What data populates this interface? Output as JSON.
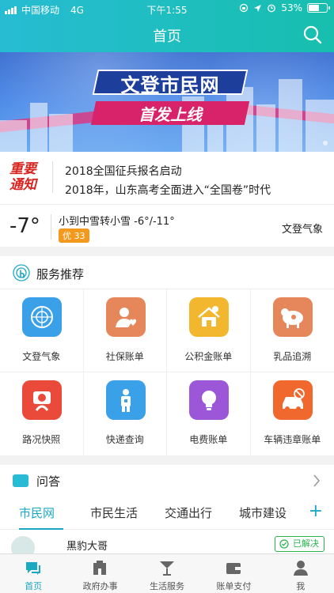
{
  "status_bar": {
    "carrier": "中国移动",
    "network": "4G",
    "time": "下午1:55",
    "battery_pct": "53%",
    "battery_level": 0.53
  },
  "nav": {
    "title": "首页",
    "search_icon": "search-icon"
  },
  "banner": {
    "title": "文登市民网",
    "subtitle": "首发上线"
  },
  "notice": {
    "logo_line1": "重要",
    "logo_line2": "通知",
    "items": [
      "2018全国征兵报名启动",
      "2018年，山东高考全面进入“全国卷”时代"
    ]
  },
  "weather": {
    "temp": "-7°",
    "condition": "小到中雪转小雪 -6°/-11°",
    "aqi": "优 33",
    "source": "文登气象"
  },
  "services": {
    "title": "服务推荐",
    "items": [
      {
        "label": "文登气象",
        "icon": "globe-icon",
        "color": "#3aa0e8"
      },
      {
        "label": "社保账单",
        "icon": "person-heart-icon",
        "color": "#e5875a"
      },
      {
        "label": "公积金账单",
        "icon": "house-coin-icon",
        "color": "#f3b72f"
      },
      {
        "label": "乳品追溯",
        "icon": "cow-icon",
        "color": "#e5875a"
      },
      {
        "label": "路况快照",
        "icon": "camera-road-icon",
        "color": "#ea4a3a"
      },
      {
        "label": "快递查询",
        "icon": "courier-icon",
        "color": "#3aa0e8"
      },
      {
        "label": "电费账单",
        "icon": "bulb-icon",
        "color": "#9c57d8"
      },
      {
        "label": "车辆违章账单",
        "icon": "car-ban-icon",
        "color": "#f0682e"
      }
    ]
  },
  "qa": {
    "title": "问答",
    "tabs": [
      "市民网",
      "市民生活",
      "交通出行",
      "城市建设"
    ],
    "active_tab": 0,
    "add_label": "+",
    "first_user": "黑豹大哥",
    "resolved_label": "已解决"
  },
  "tabbar": {
    "items": [
      {
        "label": "首页",
        "icon": "chat-home-icon"
      },
      {
        "label": "政府办事",
        "icon": "government-icon"
      },
      {
        "label": "生活服务",
        "icon": "cocktail-icon"
      },
      {
        "label": "账单支付",
        "icon": "wallet-icon"
      },
      {
        "label": "我",
        "icon": "user-icon"
      }
    ],
    "active": 0
  },
  "colors": {
    "header": "#1fbdc4",
    "accent": "#1ba8c3",
    "notice_red": "#d8231f",
    "aqi_orange": "#f39a1e",
    "resolved_green": "#2ab24d"
  }
}
